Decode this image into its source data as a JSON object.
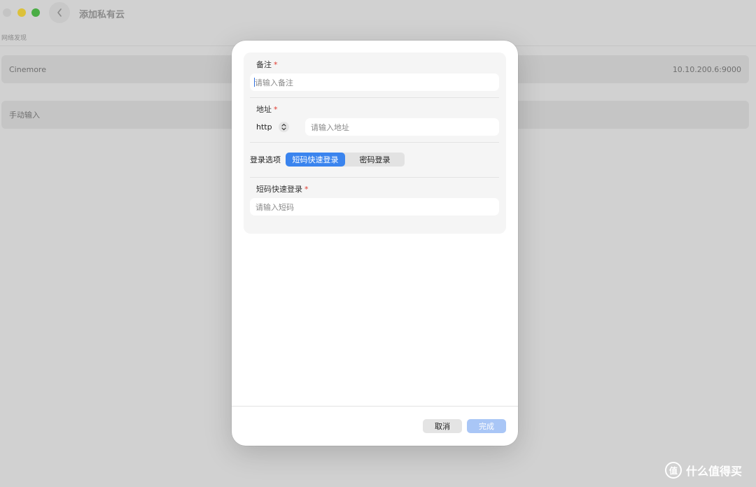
{
  "window": {
    "title": "添加私有云",
    "section_label": "网络发现"
  },
  "servers": [
    {
      "name": "Cinemore",
      "address": "10.10.200.6:9000"
    },
    {
      "name": "手动输入",
      "address": ""
    }
  ],
  "form": {
    "note_label": "备注",
    "note_placeholder": "请输入备注",
    "address_label": "地址",
    "protocol": "http",
    "address_placeholder": "请输入地址",
    "login_options_label": "登录选项",
    "login_options": [
      "短码快速登录",
      "密码登录"
    ],
    "selected_login_option": "短码快速登录",
    "shortcode_label": "短码快速登录",
    "shortcode_placeholder": "请输入短码",
    "required_mark": "*"
  },
  "footer": {
    "cancel_label": "取消",
    "done_label": "完成"
  },
  "watermark": {
    "logo_text": "值",
    "text": "什么值得买"
  },
  "colors": {
    "accent": "#3a84ee",
    "done_disabled": "#a9c6f6",
    "required": "#e03a2f"
  }
}
